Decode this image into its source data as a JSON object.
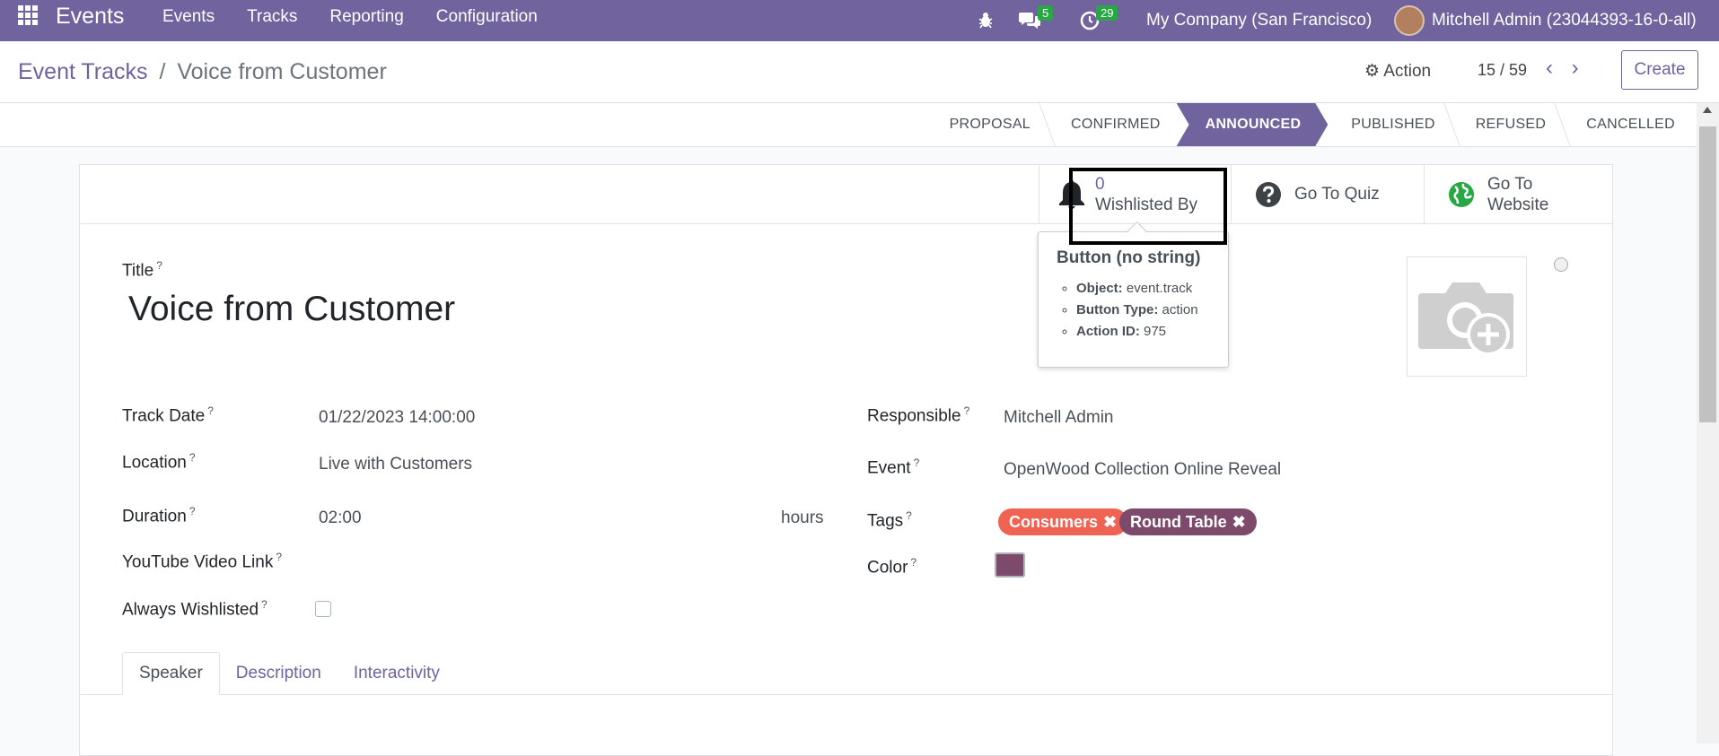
{
  "navbar": {
    "brand": "Events",
    "menu": [
      "Events",
      "Tracks",
      "Reporting",
      "Configuration"
    ],
    "messages_count": "5",
    "activities_count": "29",
    "company": "My Company (San Francisco)",
    "user": "Mitchell Admin (23044393-16-0-all)"
  },
  "breadcrumb": {
    "parent": "Event Tracks",
    "separator": "/",
    "current": "Voice from Customer"
  },
  "control": {
    "action_label": "Action",
    "pager": "15 / 59",
    "create_label": "Create"
  },
  "stages": [
    {
      "label": "PROPOSAL",
      "active": false
    },
    {
      "label": "CONFIRMED",
      "active": false
    },
    {
      "label": "ANNOUNCED",
      "active": true
    },
    {
      "label": "PUBLISHED",
      "active": false
    },
    {
      "label": "REFUSED",
      "active": false
    },
    {
      "label": "CANCELLED",
      "active": false
    }
  ],
  "smart_buttons": {
    "wishlist_value": "0",
    "wishlist_label": "Wishlisted By",
    "quiz_label": "Go To Quiz",
    "website_label_1": "Go To",
    "website_label_2": "Website"
  },
  "tooltip": {
    "title": "Button (no string)",
    "object_label": "Object:",
    "object_value": "event.track",
    "type_label": "Button Type:",
    "type_value": "action",
    "action_label": "Action ID:",
    "action_value": "975"
  },
  "form": {
    "title_label": "Title",
    "title_value": "Voice from Customer",
    "help_mark": "?",
    "track_date_label": "Track Date",
    "track_date_value": "01/22/2023 14:00:00",
    "location_label": "Location",
    "location_value": "Live with Customers",
    "duration_label": "Duration",
    "duration_value": "02:00",
    "duration_unit": "hours",
    "youtube_label": "YouTube Video Link",
    "always_wishlisted_label": "Always Wishlisted",
    "responsible_label": "Responsible",
    "responsible_value": "Mitchell Admin",
    "event_label": "Event",
    "event_value": "OpenWood Collection Online Reveal",
    "tags_label": "Tags",
    "tags": [
      {
        "label": "Consumers",
        "color": "#ee6352"
      },
      {
        "label": "Round Table",
        "color": "#7e4a6b"
      }
    ],
    "color_label": "Color",
    "color_value": "#7e4a6b"
  },
  "tabs": [
    "Speaker",
    "Description",
    "Interactivity"
  ],
  "colors": {
    "brand": "#71639e",
    "green_badge": "#28a745"
  }
}
